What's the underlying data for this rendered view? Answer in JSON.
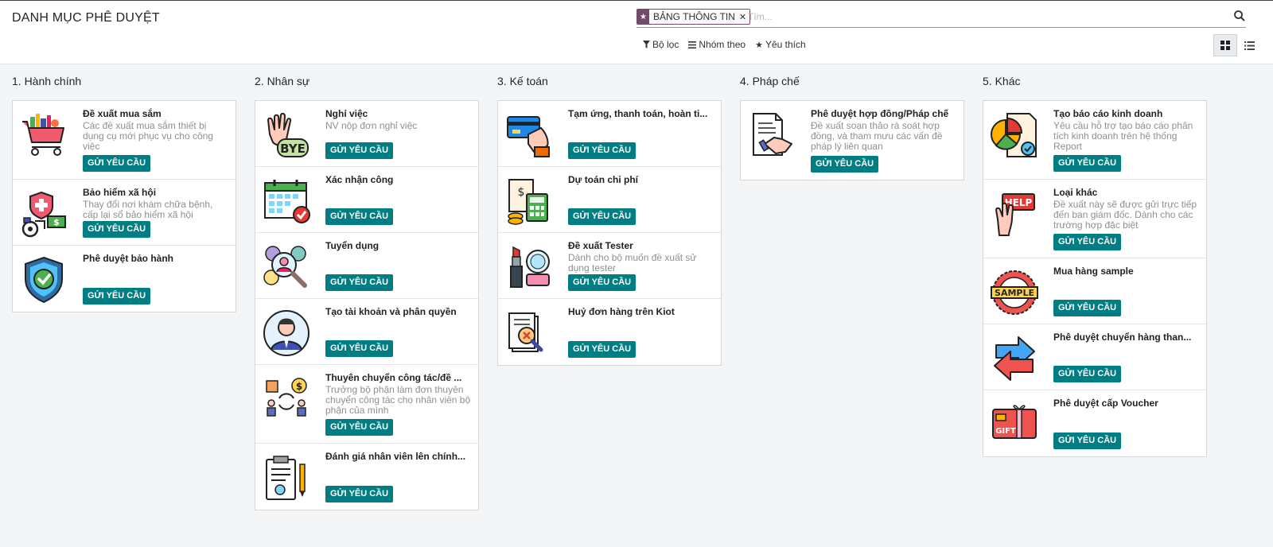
{
  "header": {
    "title": "DANH MỤC PHÊ DUYỆT",
    "facet_label": "BẢNG THÔNG TIN",
    "search_placeholder": "Tìm...",
    "filter_label": "Bộ lọc",
    "group_label": "Nhóm theo",
    "favorite_label": "Yêu thích"
  },
  "button_label": "GỬI YÊU CẦU",
  "accent_color": "#017e84",
  "facet_color": "#714b67",
  "columns": [
    {
      "title": "1. Hành chính",
      "cards": [
        {
          "name": "Đề xuất mua sắm",
          "desc": "Các đề xuất mua sắm thiết bị dụng cụ mới phục vụ cho công việc",
          "icon": "shopping-cart-icon"
        },
        {
          "name": "Bảo hiểm xã hội",
          "desc": "Thay đổi nơi khám chữa bệnh, cấp lại sổ bảo hiểm xã hội",
          "icon": "health-insurance-icon"
        },
        {
          "name": "Phê duyệt bảo hành",
          "desc": "",
          "icon": "warranty-shield-icon"
        }
      ]
    },
    {
      "title": "2. Nhân sự",
      "cards": [
        {
          "name": "Nghỉ việc",
          "desc": "NV nộp đơn nghỉ việc",
          "icon": "bye-hand-icon"
        },
        {
          "name": "Xác nhận công",
          "desc": "",
          "icon": "calendar-check-icon"
        },
        {
          "name": "Tuyển dụng",
          "desc": "",
          "icon": "recruitment-icon"
        },
        {
          "name": "Tạo tài khoản và phân quyền",
          "desc": "",
          "icon": "user-account-icon"
        },
        {
          "name": "Thuyên chuyển công tác/đề ...",
          "desc": "Trưởng bộ phận làm đơn thuyên chuyển công tác cho nhân viên bộ phận của mình",
          "icon": "transfer-icon"
        },
        {
          "name": "Đánh giá nhân viên lên chính...",
          "desc": "",
          "icon": "clipboard-evaluation-icon"
        }
      ]
    },
    {
      "title": "3. Kế toán",
      "cards": [
        {
          "name": "Tạm ứng, thanh toán, hoàn ti...",
          "desc": "",
          "icon": "credit-card-icon"
        },
        {
          "name": "Dự toán chi phí",
          "desc": "",
          "icon": "calculator-icon"
        },
        {
          "name": "Đề xuất Tester",
          "desc": "Dành cho bộ muốn đề xuất sử dụng tester",
          "icon": "cosmetics-icon"
        },
        {
          "name": "Huỷ đơn hàng trên Kiot",
          "desc": "",
          "icon": "cancel-order-icon"
        }
      ]
    },
    {
      "title": "4. Pháp chế",
      "cards": [
        {
          "name": "Phê duyệt hợp đồng/Pháp chế",
          "desc": "Đề xuất soạn thảo rà soát hợp đồng, và tham mưu các vấn đề pháp lý liên quan",
          "icon": "contract-handshake-icon"
        }
      ]
    },
    {
      "title": "5. Khác",
      "cards": [
        {
          "name": "Tạo báo cáo kinh doanh",
          "desc": "Yêu cầu hỗ trợ tạo báo cáo phân tích kinh doanh trên hệ thống Report",
          "icon": "business-report-icon"
        },
        {
          "name": "Loại khác",
          "desc": "Đề xuất này sẽ được gửi trực tiếp đến ban giám đốc. Dành cho các trường hợp đặc biệt",
          "icon": "help-sign-icon"
        },
        {
          "name": "Mua hàng sample",
          "desc": "",
          "icon": "sample-badge-icon"
        },
        {
          "name": "Phê duyệt chuyển hàng than...",
          "desc": "",
          "icon": "transfer-arrows-icon"
        },
        {
          "name": "Phê duyệt cấp Voucher",
          "desc": "",
          "icon": "gift-voucher-icon"
        }
      ]
    }
  ]
}
